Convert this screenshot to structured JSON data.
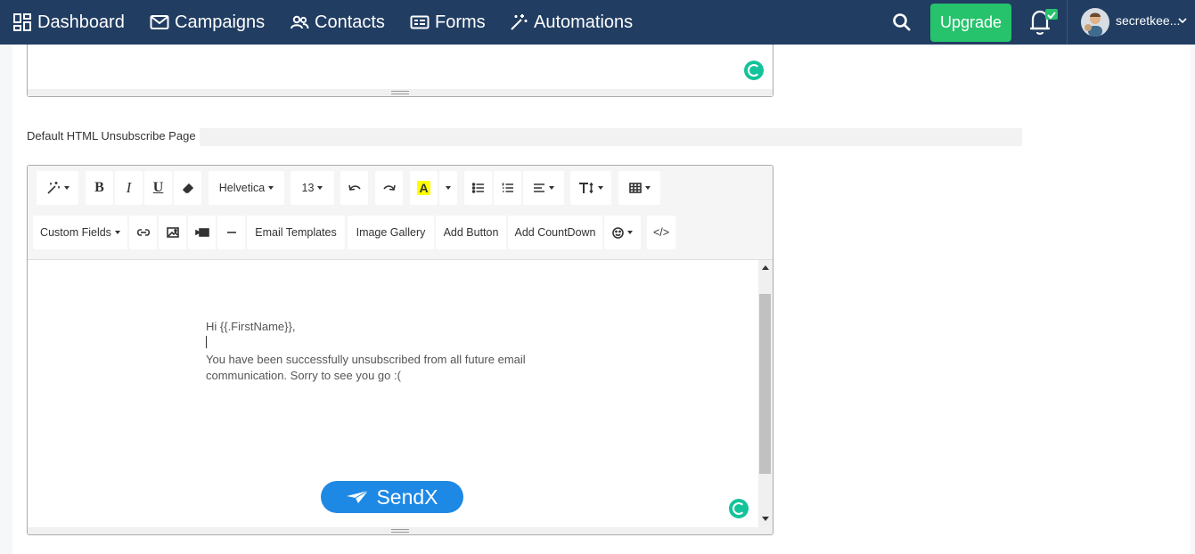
{
  "nav": {
    "dashboard": "Dashboard",
    "campaigns": "Campaigns",
    "contacts": "Contacts",
    "forms": "Forms",
    "automations": "Automations",
    "upgrade": "Upgrade",
    "user": "secretkee...",
    "icons": [
      "grid-icon",
      "envelope-icon",
      "people-icon",
      "form-icon",
      "magic-wand-icon",
      "search-icon",
      "bell-icon",
      "avatar",
      "chevron-down-icon"
    ]
  },
  "colors": {
    "navbar": "#213d62",
    "upgrade": "#27c26c",
    "sendx": "#1e88e5",
    "grammarly": "#15c39a"
  },
  "section": {
    "label": "Default HTML Unsubscribe Page"
  },
  "toolbar": {
    "font_family": "Helvetica",
    "font_size": "13",
    "custom_fields": "Custom Fields",
    "email_templates": "Email Templates",
    "image_gallery": "Image Gallery",
    "add_button": "Add Button",
    "add_countdown": "Add CountDown",
    "code_view": "</>"
  },
  "content": {
    "greeting": "Hi {{.FirstName}},",
    "message": "You have been successfully unsubscribed from all future email communication. Sorry to see you go :(",
    "brand": "SendX"
  }
}
